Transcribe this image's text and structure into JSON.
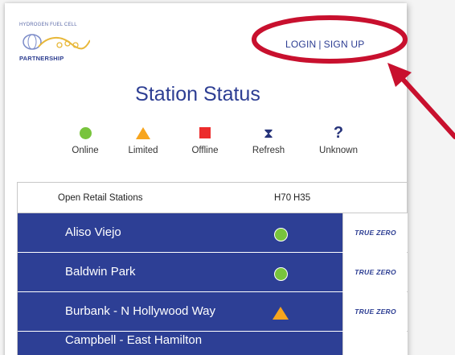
{
  "logo": {
    "top_text": "HYDROGEN FUEL CELL",
    "bottom_text": "PARTNERSHIP"
  },
  "auth": {
    "login_label": "LOGIN",
    "separator": "|",
    "signup_label": "SIGN UP"
  },
  "title": "Station Status",
  "legend": [
    {
      "icon": "online-dot-icon",
      "label": "Online",
      "color": "#78c43c"
    },
    {
      "icon": "limited-triangle-icon",
      "label": "Limited",
      "color": "#f7a51e"
    },
    {
      "icon": "offline-square-icon",
      "label": "Offline",
      "color": "#ec2c2c"
    },
    {
      "icon": "hourglass-icon",
      "glyph": "⧗",
      "label": "Refresh"
    },
    {
      "icon": "question-icon",
      "glyph": "?",
      "label": "Unknown"
    }
  ],
  "table": {
    "header": {
      "label": "Open Retail Stations",
      "h70": "H70",
      "h35": "H35"
    },
    "rows": [
      {
        "name": "Aliso Viejo",
        "status": "online",
        "provider": "TRUE ZERO"
      },
      {
        "name": "Baldwin Park",
        "status": "online",
        "provider": "TRUE ZERO"
      },
      {
        "name": "Burbank - N Hollywood Way",
        "status": "limited",
        "provider": "TRUE ZERO"
      },
      {
        "name": "Campbell - East Hamilton",
        "status": "",
        "provider": ""
      }
    ]
  },
  "colors": {
    "brand_blue": "#2d3f95",
    "annotation_red": "#c8102e"
  }
}
